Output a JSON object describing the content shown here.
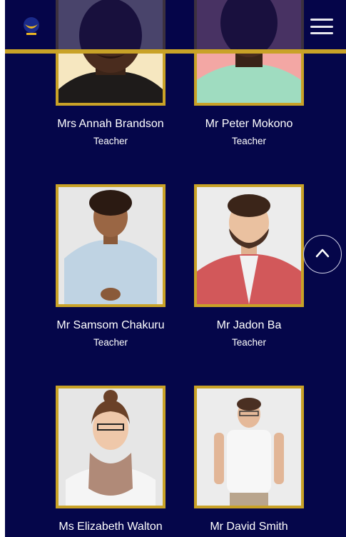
{
  "header": {
    "logo_icon": "school-crest-icon",
    "menu_icon": "hamburger-menu-icon"
  },
  "colors": {
    "background": "#05064a",
    "accent": "#c9a227",
    "text": "#ffffff"
  },
  "staff": [
    {
      "name": "Mrs Annah Brandson",
      "role": "Teacher"
    },
    {
      "name": "Mr Peter Mokono",
      "role": "Teacher"
    },
    {
      "name": "Mr Samsom Chakuru",
      "role": "Teacher"
    },
    {
      "name": "Mr Jadon Ba",
      "role": "Teacher"
    },
    {
      "name": "Ms Elizabeth Walton",
      "role": ""
    },
    {
      "name": "Mr David Smith",
      "role": ""
    }
  ],
  "scroll_top_icon": "chevron-up-icon"
}
